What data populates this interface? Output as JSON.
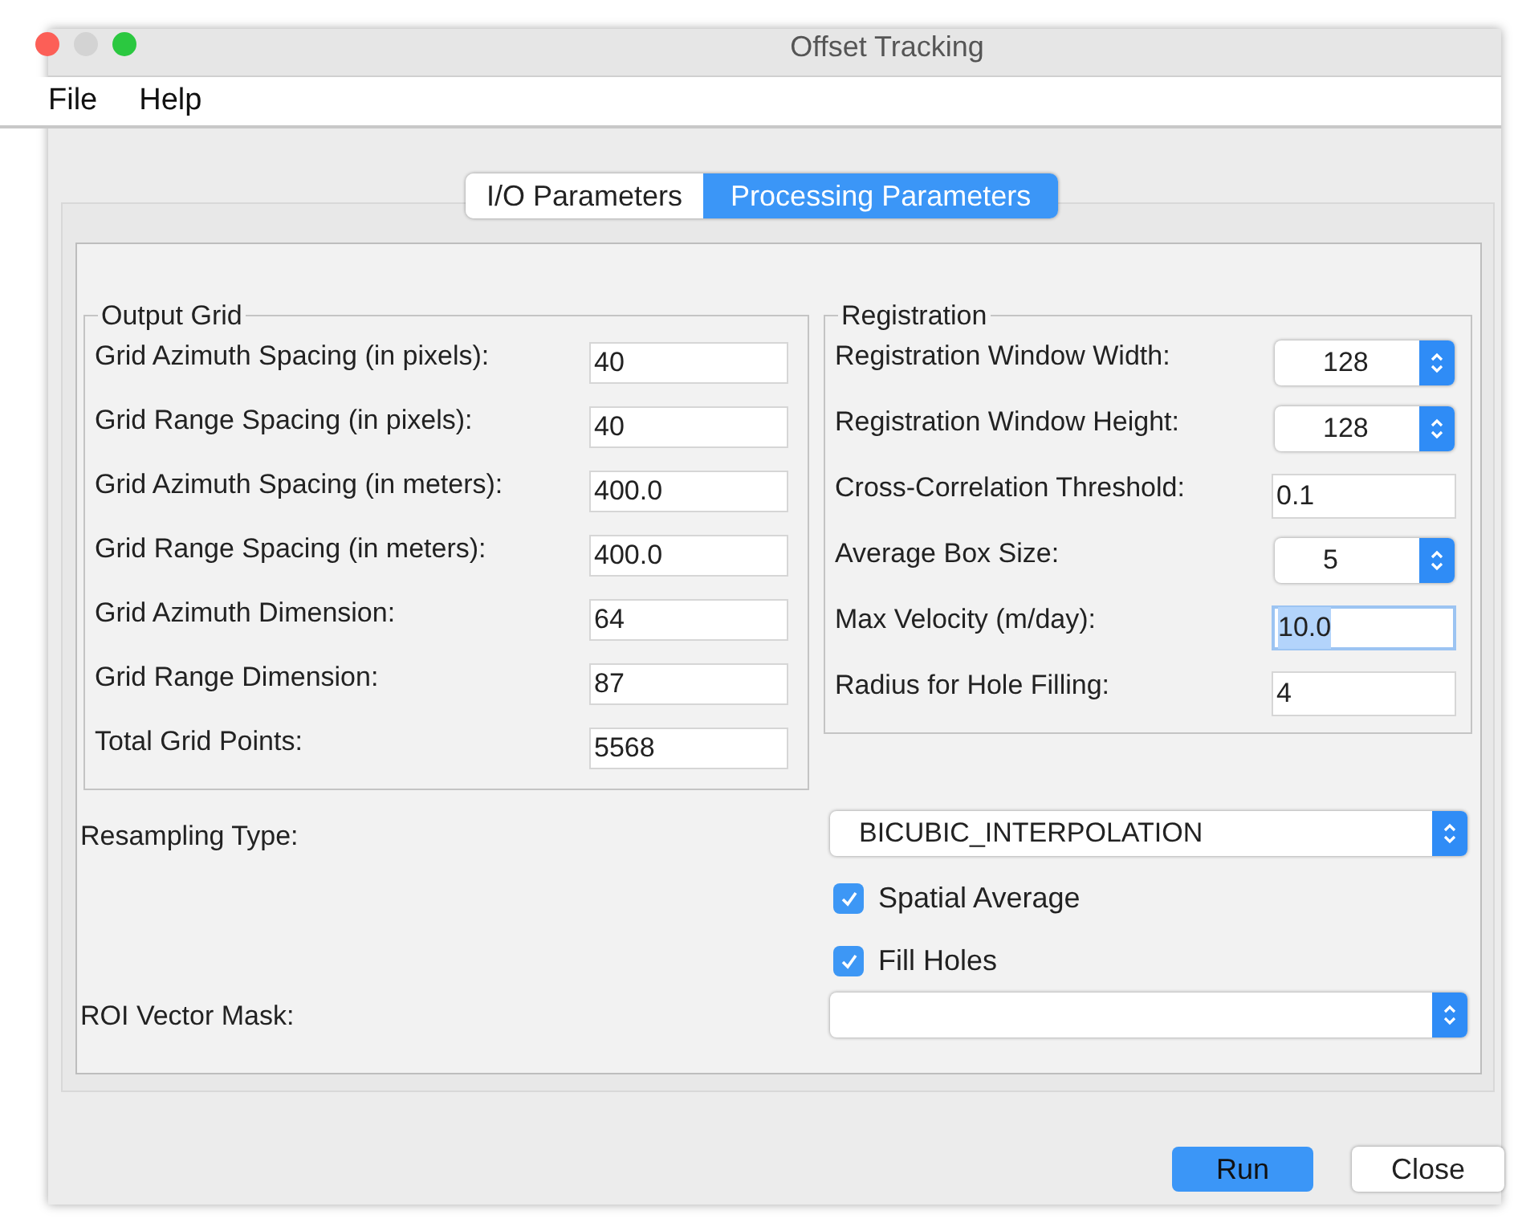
{
  "window": {
    "title": "Offset Tracking"
  },
  "menu": [
    "File",
    "Help"
  ],
  "tabs": [
    {
      "label": "I/O Parameters",
      "selected": false
    },
    {
      "label": "Processing Parameters",
      "selected": true
    }
  ],
  "output_grid": {
    "title": "Output Grid",
    "fields": [
      {
        "label": "Grid Azimuth Spacing (in pixels):",
        "value": "40"
      },
      {
        "label": "Grid Range Spacing (in pixels):",
        "value": "40"
      },
      {
        "label": "Grid Azimuth Spacing (in meters):",
        "value": "400.0"
      },
      {
        "label": "Grid Range Spacing (in meters):",
        "value": "400.0"
      },
      {
        "label": "Grid Azimuth Dimension:",
        "value": "64"
      },
      {
        "label": "Grid Range Dimension:",
        "value": "87"
      },
      {
        "label": "Total Grid Points:",
        "value": "5568"
      }
    ]
  },
  "registration": {
    "title": "Registration",
    "fields": [
      {
        "label": "Registration Window Width:",
        "value": "128",
        "kind": "spinner"
      },
      {
        "label": "Registration Window Height:",
        "value": "128",
        "kind": "spinner"
      },
      {
        "label": "Cross-Correlation Threshold:",
        "value": "0.1",
        "kind": "text",
        "focused": false
      },
      {
        "label": "Average Box Size:",
        "value": "5",
        "kind": "spinner"
      },
      {
        "label": "Max Velocity (m/day):",
        "value": "10.0",
        "kind": "text",
        "focused": true
      },
      {
        "label": "Radius for Hole Filling:",
        "value": "4",
        "kind": "text",
        "focused": false
      }
    ]
  },
  "resampling_type": {
    "label": "Resampling Type:",
    "value": "BICUBIC_INTERPOLATION"
  },
  "checkboxes": [
    {
      "label": "Spatial Average",
      "checked": true
    },
    {
      "label": "Fill Holes",
      "checked": true
    }
  ],
  "roi_vector_mask": {
    "label": "ROI Vector Mask:"
  },
  "buttons": [
    {
      "label": "Run",
      "kind": "primary"
    },
    {
      "label": "Close",
      "kind": "secondary"
    }
  ]
}
